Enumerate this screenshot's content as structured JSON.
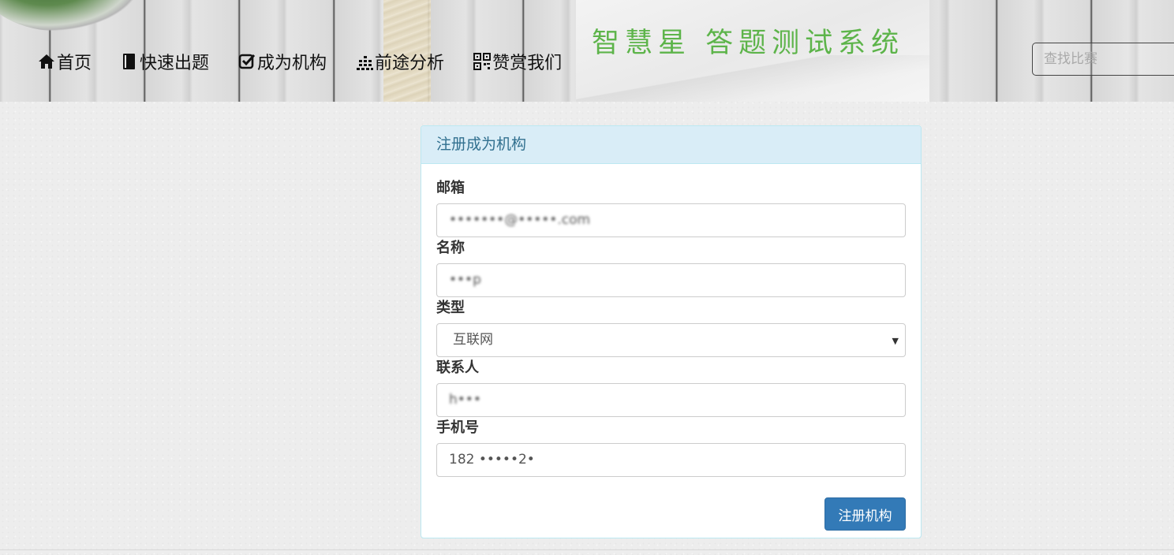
{
  "header": {
    "site_title": "智慧星 答题测试系统",
    "nav": [
      {
        "label": "首页",
        "icon": "home-icon"
      },
      {
        "label": "快速出题",
        "icon": "book-icon"
      },
      {
        "label": "成为机构",
        "icon": "check-square-icon"
      },
      {
        "label": "前途分析",
        "icon": "bar-grid-icon"
      },
      {
        "label": "赞赏我们",
        "icon": "qrcode-icon"
      }
    ],
    "search": {
      "placeholder": "查找比赛",
      "value": ""
    }
  },
  "panel": {
    "title": "注册成为机构",
    "fields": {
      "email": {
        "label": "邮箱",
        "value": "•••••••@•••••.com"
      },
      "name": {
        "label": "名称",
        "value": "•••p"
      },
      "type": {
        "label": "类型",
        "value": "互联网"
      },
      "contact": {
        "label": "联系人",
        "value": "h•••"
      },
      "phone": {
        "label": "手机号",
        "value": "182 •••••2•"
      }
    },
    "submit_label": "注册机构"
  },
  "colors": {
    "title_green": "#5db44a",
    "panel_heading_bg": "#d9edf7",
    "panel_heading_text": "#31708f",
    "primary_button": "#337ab7"
  }
}
